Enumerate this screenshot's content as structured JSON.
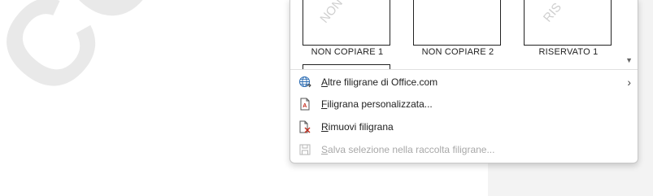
{
  "document": {
    "watermark_text": "COPIARE"
  },
  "gallery": {
    "tiles": [
      {
        "label": "NON COPIARE 1",
        "thumb_text": "NON"
      },
      {
        "label": "NON COPIARE 2",
        "thumb_text": ""
      },
      {
        "label": "RISERVATO 1",
        "thumb_text": "RIS"
      }
    ]
  },
  "menu": {
    "items": [
      {
        "label_accel": "A",
        "label_rest": "ltre filigrane di Office.com",
        "icon": "globe-icon",
        "has_submenu": true,
        "enabled": true
      },
      {
        "label_accel": "F",
        "label_rest": "iligrana personalizzata...",
        "icon": "document-watermark-icon",
        "enabled": true
      },
      {
        "label_accel": "R",
        "label_rest": "imuovi filigrana",
        "icon": "remove-watermark-icon",
        "enabled": true
      },
      {
        "label_accel": "S",
        "label_rest": "alva selezione nella raccolta filigrane...",
        "icon": "save-to-gallery-icon",
        "enabled": false
      }
    ]
  },
  "icons": {
    "submenu_chevron": "chevron-right-icon",
    "scroll_down": "scroll-down-icon"
  },
  "colors": {
    "accent_red": "#c42b1c",
    "globe_blue": "#2f6fb5",
    "disabled_text": "#a8a8a8"
  }
}
